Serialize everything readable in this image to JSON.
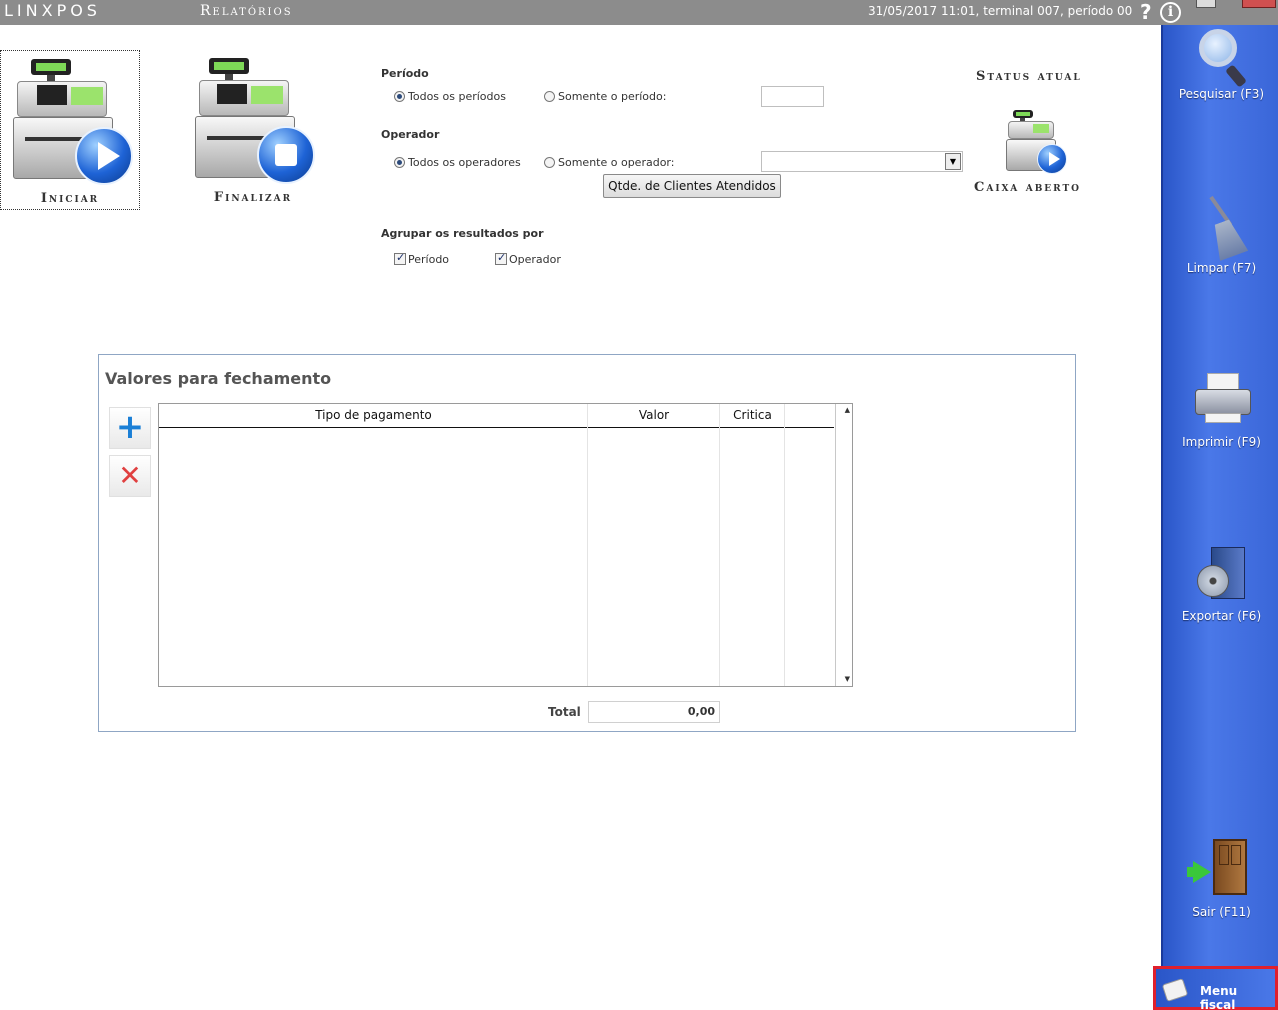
{
  "titlebar": {
    "logo": "LINXPOS",
    "module": "Relatórios",
    "status_line": "31/05/2017 11:01, terminal 007, período 00",
    "help": "?",
    "info": "i"
  },
  "actions": {
    "iniciar": "Iniciar",
    "finalizar": "Finalizar"
  },
  "filters": {
    "periodo": {
      "title": "Período",
      "all_label": "Todos os períodos",
      "only_label": "Somente o período:",
      "value": ""
    },
    "operador": {
      "title": "Operador",
      "all_label": "Todos os operadores",
      "only_label": "Somente o operador:",
      "selected": ""
    },
    "clientes_button": "Qtde. de Clientes Atendidos",
    "agrupar": {
      "title": "Agrupar os resultados por",
      "periodo_label": "Período",
      "periodo_checked": true,
      "operador_label": "Operador",
      "operador_checked": true
    }
  },
  "status": {
    "title": "Status atual",
    "value": "Caixa aberto"
  },
  "valores": {
    "title": "Valores para fechamento",
    "add_icon": "+",
    "remove_icon": "✕",
    "columns": [
      "Tipo de pagamento",
      "Valor",
      "Critica"
    ],
    "rows": [],
    "total_label": "Total",
    "total_value": "0,00"
  },
  "sidebar": {
    "items": [
      {
        "label": "Pesquisar (F3)",
        "icon": "magnifier-icon"
      },
      {
        "label": "Limpar (F7)",
        "icon": "broom-icon"
      },
      {
        "label": "Imprimir (F9)",
        "icon": "printer-icon"
      },
      {
        "label": "Exportar (F6)",
        "icon": "export-disc-icon"
      },
      {
        "label": "Sair (F11)",
        "icon": "exit-door-icon"
      }
    ],
    "menu_fiscal": "Menu fiscal"
  },
  "colors": {
    "titlebar": "#8c8c8c",
    "sidebar": "#3a66d8",
    "highlight": "#e0202c",
    "accent_blue": "#1e63d6"
  }
}
